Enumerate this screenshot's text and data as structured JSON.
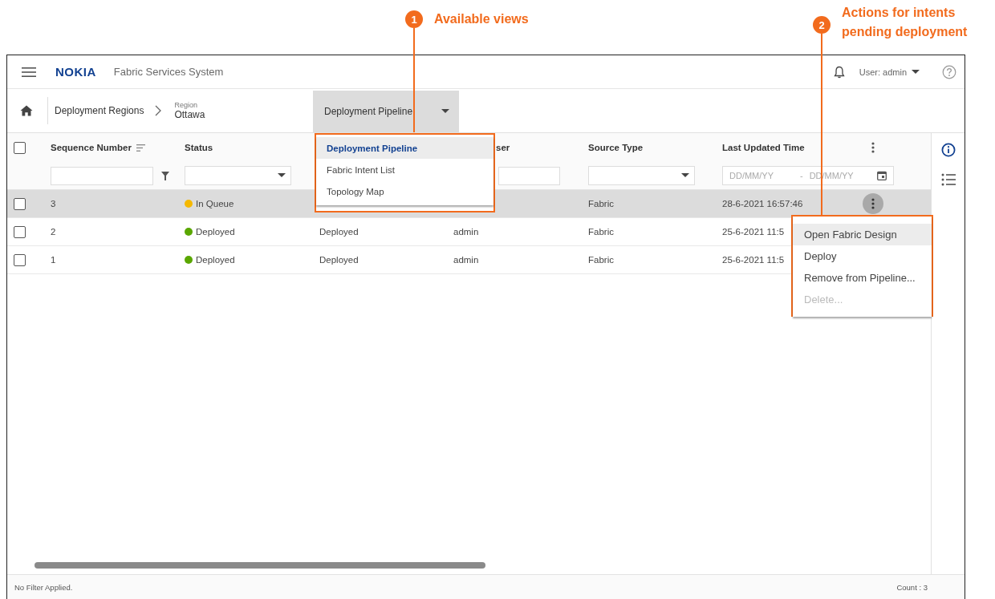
{
  "annotations": [
    {
      "number": "1",
      "text": "Available views"
    },
    {
      "number": "2",
      "text": "Actions for intents pending deployment"
    }
  ],
  "header": {
    "logo": "NOKIA",
    "title": "Fabric Services System",
    "user": "User: admin"
  },
  "breadcrumb": {
    "items": [
      "Deployment Regions"
    ],
    "current_label": "Region",
    "current_value": "Ottawa"
  },
  "view_selector": {
    "value": "Deployment Pipeline",
    "expanded": true,
    "options": [
      {
        "label": "Deployment Pipeline",
        "selected": true
      },
      {
        "label": "Fabric Intent List",
        "selected": false
      },
      {
        "label": "Topology Map",
        "selected": false
      }
    ]
  },
  "table": {
    "all_checked": false,
    "columns": [
      {
        "label": "Sequence Number",
        "sort_icon": true,
        "filter": {
          "kind": "text",
          "has_filter_icon": true
        }
      },
      {
        "label": "Status",
        "filter": {
          "kind": "select"
        }
      },
      {},
      {
        "label": "ser",
        "filter": {
          "kind": "text"
        }
      },
      {
        "label": "Source Type",
        "filter": {
          "kind": "select"
        }
      },
      {
        "label": "Last Updated Time",
        "filter": {
          "kind": "date",
          "from_placeholder": "DD/MM/YY",
          "separator": "-",
          "to_placeholder": "DD/MM/YY"
        }
      }
    ],
    "rows": [
      {
        "selected": true,
        "checked": false,
        "has_actions": true,
        "sequence": "3",
        "status": "In Queue",
        "color": "#f5b800",
        "source_type": "Fabric",
        "last_updated": "28-6-2021 16:57:46"
      },
      {
        "selected": false,
        "checked": false,
        "has_actions": false,
        "sequence": "2",
        "status": "Deployed",
        "color": "#5aa700",
        "column_3": "Deployed",
        "user": "admin",
        "source_type": "Fabric",
        "last_updated": "25-6-2021 11:5"
      },
      {
        "selected": false,
        "checked": false,
        "has_actions": false,
        "sequence": "1",
        "status": "Deployed",
        "color": "#5aa700",
        "column_3": "Deployed",
        "user": "admin",
        "source_type": "Fabric",
        "last_updated": "25-6-2021 11:5"
      }
    ]
  },
  "actions_menu": {
    "items": [
      {
        "label": "Open Fabric Design",
        "selected": true,
        "disabled": false
      },
      {
        "label": "Deploy",
        "selected": false,
        "disabled": false
      },
      {
        "label": "Remove from Pipeline...",
        "selected": false,
        "disabled": false
      },
      {
        "label": "Delete...",
        "selected": false,
        "disabled": true
      }
    ]
  },
  "footer": {
    "filter_text": "No Filter Applied.",
    "count": "Count : 3"
  }
}
